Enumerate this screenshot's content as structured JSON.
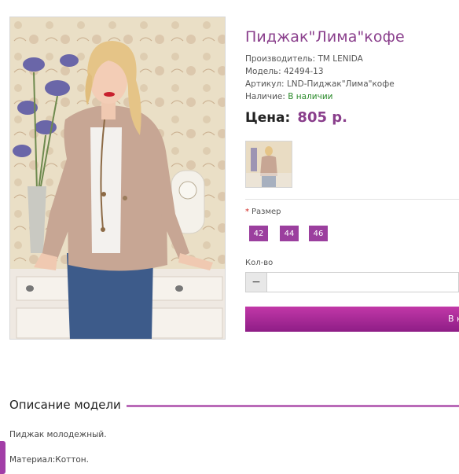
{
  "product": {
    "title": "Пиджак\"Лима\"кофе",
    "manufacturer_label": "Производитель:",
    "manufacturer_value": "TM LENIDA",
    "model_label": "Модель:",
    "model_value": "42494-13",
    "sku_label": "Артикул:",
    "sku_value": "LND-Пиджак\"Лима\"кофе",
    "availability_label": "Наличие:",
    "availability_value": "В наличии",
    "price_label": "Цена:",
    "price_value": "805 р."
  },
  "options": {
    "required_mark": "*",
    "size_label": "Размер",
    "sizes": [
      "42",
      "44",
      "46"
    ]
  },
  "quantity": {
    "label": "Кол-во",
    "minus": "−",
    "value": ""
  },
  "cart": {
    "button_label": "В к"
  },
  "description": {
    "heading": "Описание модели",
    "line1": "Пиджак молодежный.",
    "line2": "Материал:Коттон."
  },
  "colors": {
    "accent": "#8a3f8c",
    "button": "#9b3f9e",
    "available": "#2a8a2a"
  }
}
